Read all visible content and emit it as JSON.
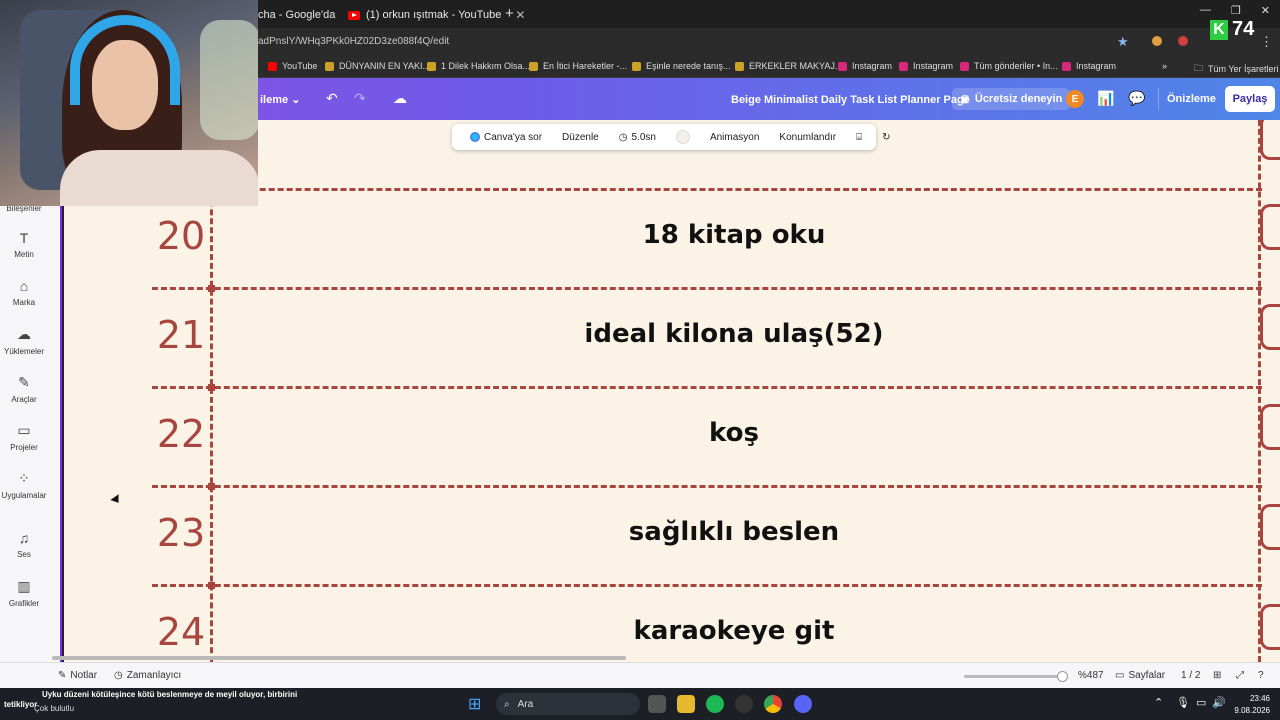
{
  "browser": {
    "tabs": [
      {
        "label": "cha - Google'da"
      },
      {
        "label": "(1) orkun ışıtmak - YouTube"
      }
    ],
    "url": "adPnslY/WHq3PKk0HZ02D3ze088f4Q/edit",
    "bookmarks": [
      {
        "label": "YouTube",
        "color": "#ff0000"
      },
      {
        "label": "DÜNYANIN EN YAKI...",
        "color": "#c9a227"
      },
      {
        "label": "1 Dilek Hakkım Olsa...",
        "color": "#c9a227"
      },
      {
        "label": "En İtici Hareketler -...",
        "color": "#c9a227"
      },
      {
        "label": "Eşinle nerede tanış...",
        "color": "#c9a227"
      },
      {
        "label": "ERKEKLER MAKYAJ...",
        "color": "#c9a227"
      },
      {
        "label": "Instagram",
        "color": "#d6297b"
      },
      {
        "label": "Instagram",
        "color": "#d6297b"
      },
      {
        "label": "Tüm gönderiler • In...",
        "color": "#d6297b"
      },
      {
        "label": "Instagram",
        "color": "#d6297b"
      }
    ],
    "bookmarks_more": "»",
    "all_bookmarks": "Tüm Yer İşaretleri",
    "overlay_badge": "74"
  },
  "canva": {
    "header": {
      "menu_label": "ileme",
      "doc_title": "Beige Minimalist Daily Task List Planner Page",
      "trial_label": "Ücretsiz deneyin",
      "avatar_letter": "E",
      "preview_label": "Önizleme",
      "share_label": "Paylaş"
    },
    "floating_toolbar": {
      "ask": "Canva'ya sor",
      "edit": "Düzenle",
      "duration": "5.0sn",
      "animation": "Animasyon",
      "position": "Konumlandır"
    },
    "sidebar": [
      {
        "label": "Bileşenler",
        "icon": "elements-icon"
      },
      {
        "label": "Metin",
        "icon": "text-icon"
      },
      {
        "label": "Marka",
        "icon": "brand-icon"
      },
      {
        "label": "Yüklemeler",
        "icon": "upload-icon"
      },
      {
        "label": "Araçlar",
        "icon": "tools-icon"
      },
      {
        "label": "Projeler",
        "icon": "folder-icon"
      },
      {
        "label": "Uygulamalar",
        "icon": "apps-icon"
      },
      {
        "label": "Ses",
        "icon": "music-icon"
      },
      {
        "label": "Grafikler",
        "icon": "chart-icon"
      }
    ],
    "rows": [
      {
        "num": "20",
        "text": "18 kitap oku"
      },
      {
        "num": "21",
        "text": "ideal kilona ulaş(52)"
      },
      {
        "num": "22",
        "text": "koş"
      },
      {
        "num": "23",
        "text": "sağlıklı beslen"
      },
      {
        "num": "24",
        "text": "karaokeye git"
      }
    ],
    "bottom": {
      "notes": "Notlar",
      "timer": "Zamanlayıcı",
      "zoom": "%487",
      "pages_label": "Sayfalar",
      "page_indicator": "1 / 2"
    }
  },
  "taskbar": {
    "search_placeholder": "Ara",
    "ticker_line1": "Uyku düzeni kötüleşince kötü beslenmeye de meyil oluyor, birbirini",
    "ticker_line2": "tetikliyor",
    "weather": "Çok bulutlu",
    "time": "23:46",
    "date": "9.08.2026"
  }
}
